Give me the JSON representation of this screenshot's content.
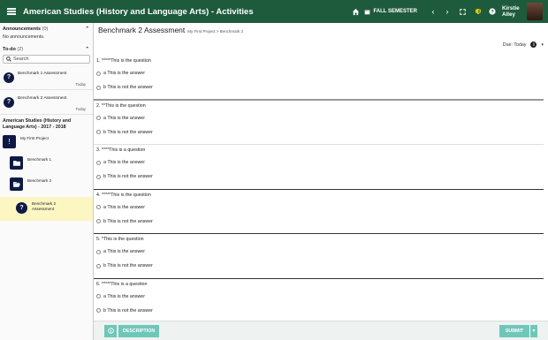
{
  "app": {
    "title": "American Studies (History and Language Arts) - Activities"
  },
  "topbar": {
    "semester_label": "FALL SEMESTER",
    "user_name": "Kirstie Alley"
  },
  "sidebar": {
    "announcements": {
      "title": "Announcements",
      "count": "(0)",
      "empty_text": "No announcements."
    },
    "todo": {
      "title": "To-do",
      "count": "(2)",
      "search_placeholder": "Search",
      "items": [
        {
          "label": "Benchmark 1 Assessment",
          "date": "Today"
        },
        {
          "label": "Benchmark 2 Assessment",
          "date": "Today"
        }
      ]
    },
    "course": {
      "title": "American Studies (History and Language Arts) - 2017 - 2018",
      "project": "My First Project",
      "folders": [
        {
          "label": "Benchmark 1"
        },
        {
          "label": "Benchmark 2"
        }
      ],
      "active_item": "Benchmark 2 Assessment"
    }
  },
  "main": {
    "title": "Benchmark 2 Assessment",
    "breadcrumb": "My First Project > Benchmark 2",
    "due": "Due: Today",
    "questions": [
      {
        "text": "1. *****This is the question",
        "answers": [
          "a  This is the answer",
          "b  This is not the answer"
        ]
      },
      {
        "text": "2. **This is the question",
        "answers": [
          "a  This is the answer",
          "b  This is not the answer"
        ]
      },
      {
        "text": "3. ****This is a question",
        "answers": [
          "a  This is the answer",
          "b  This is not the answer"
        ]
      },
      {
        "text": "4. *****This is the question",
        "answers": [
          "a  This is the answer",
          "b  This is not the answer"
        ]
      },
      {
        "text": "5. *This is the question",
        "answers": [
          "a  This is the answer",
          "b  This is not the answer"
        ]
      },
      {
        "text": "6. *****This is a question",
        "answers": [
          "a  This is the answer",
          "b  This is not the answer"
        ]
      }
    ]
  },
  "footer": {
    "description_label": "DESCRIPTION",
    "submit_label": "SUBMIT"
  },
  "colors": {
    "topbar": "#1e5b3c",
    "accent": "#6fc7b9",
    "icon_dark": "#0f1a44",
    "active_bg": "#fbf6c2"
  }
}
